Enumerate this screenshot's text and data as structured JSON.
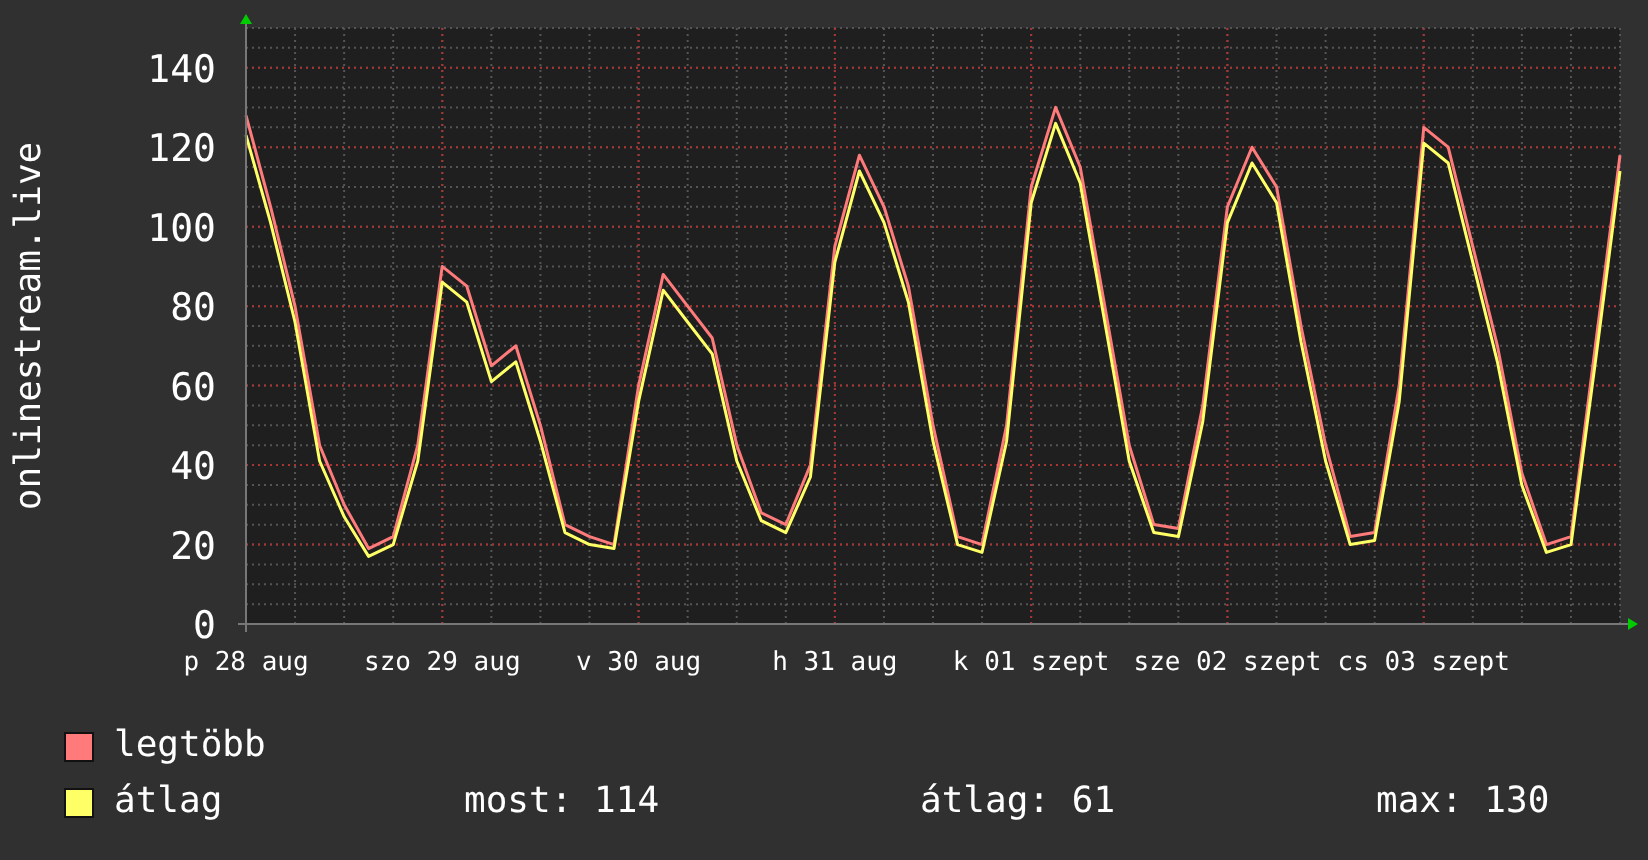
{
  "graph": {
    "chart_data": {
      "type": "line",
      "ylabel": "onlinestream.live",
      "categories": [
        "p 28 aug",
        null,
        null,
        null,
        null,
        null,
        null,
        null,
        "szo 29 aug",
        null,
        null,
        null,
        null,
        null,
        null,
        null,
        "v 30 aug",
        null,
        null,
        null,
        null,
        null,
        null,
        null,
        "h 31 aug",
        null,
        null,
        null,
        null,
        null,
        null,
        null,
        "k 01 szept",
        null,
        null,
        null,
        null,
        null,
        null,
        null,
        "sze 02 szept",
        null,
        null,
        null,
        null,
        null,
        null,
        null,
        "cs 03 szept",
        null,
        null,
        null,
        null,
        null,
        null,
        null,
        null
      ],
      "ylim": [
        0,
        150
      ],
      "grid": true,
      "yticks": [
        0,
        20,
        40,
        60,
        80,
        100,
        120,
        140
      ],
      "series": [
        {
          "color": "#ff7b7b",
          "values": [
            128,
            105,
            80,
            45,
            30,
            19,
            22,
            45,
            90,
            85,
            65,
            70,
            50,
            25,
            22,
            20,
            60,
            88,
            80,
            72,
            45,
            28,
            25,
            40,
            95,
            118,
            105,
            85,
            50,
            22,
            20,
            50,
            110,
            130,
            115,
            80,
            45,
            25,
            24,
            55,
            105,
            120,
            110,
            75,
            45,
            22,
            23,
            60,
            125,
            120,
            95,
            70,
            38,
            20,
            22,
            70,
            118
          ]
        },
        {
          "color": "#ffff66",
          "values": [
            123,
            101,
            76,
            41,
            27,
            17,
            20,
            41,
            86,
            81,
            61,
            66,
            46,
            23,
            20,
            19,
            56,
            84,
            76,
            68,
            41,
            26,
            23,
            37,
            91,
            114,
            101,
            81,
            46,
            20,
            18,
            46,
            106,
            126,
            111,
            76,
            41,
            23,
            22,
            51,
            101,
            116,
            106,
            71,
            41,
            20,
            21,
            56,
            121,
            116,
            91,
            66,
            35,
            18,
            20,
            66,
            114
          ]
        }
      ]
    }
  },
  "legend": {
    "items": [
      {
        "label": "legtöbb",
        "color": "#ff7b7b"
      },
      {
        "label": "átlag",
        "color": "#ffff66"
      }
    ],
    "stats": [
      "most: 114",
      "átlag: 61",
      "max: 130"
    ]
  }
}
